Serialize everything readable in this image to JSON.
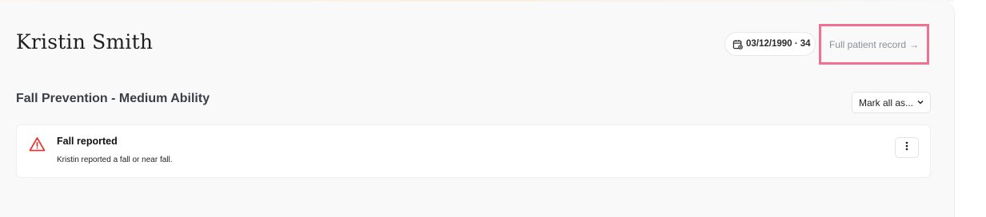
{
  "patient": {
    "name": "Kristin Smith",
    "dob_age": "03/12/1990 · 34",
    "full_record_label": "Full patient record",
    "full_record_arrow": "→"
  },
  "section": {
    "title": "Fall Prevention - Medium Ability",
    "mark_all_label": "Mark all as..."
  },
  "alerts": [
    {
      "title": "Fall reported",
      "description": "Kristin reported a fall or near fall.",
      "icon": "warning-triangle-icon",
      "icon_color": "#e5322d"
    }
  ],
  "colors": {
    "highlight_border": "#f2708f",
    "link_text": "#8a8f98",
    "panel_background": "#f9f9f9"
  }
}
